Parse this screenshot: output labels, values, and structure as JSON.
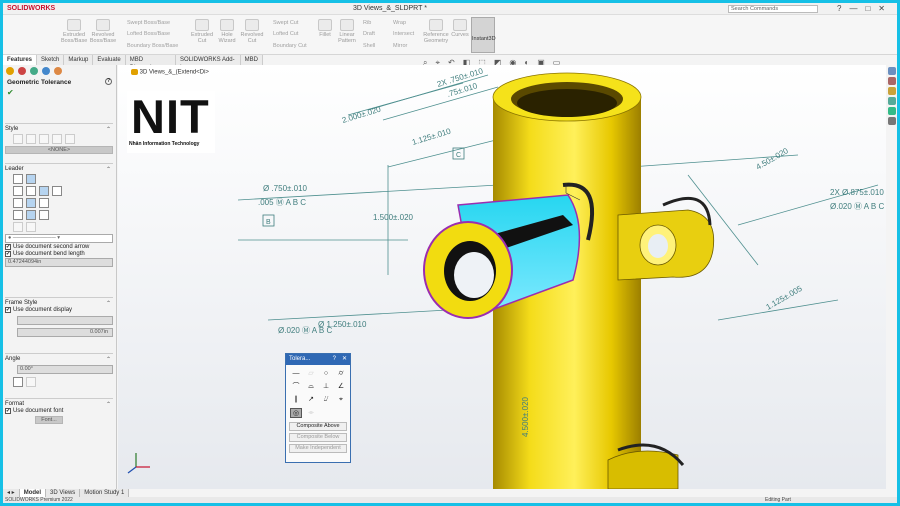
{
  "app": {
    "name": "SOLIDWORKS",
    "document_title": "3D Views_&_SLDPRT *",
    "search_placeholder": "Search Commands",
    "window_buttons": [
      "?",
      "—",
      "□",
      "✕"
    ]
  },
  "ribbon": {
    "commands": [
      {
        "label": "Swept Boss/Base"
      },
      {
        "label": "Extruded Boss/Base"
      },
      {
        "label": "Revolved Boss/Base"
      },
      {
        "label": "Lofted Boss/Base"
      },
      {
        "label": "Boundary Boss/Base"
      },
      {
        "label": "Extruded Cut"
      },
      {
        "label": "Hole Wizard"
      },
      {
        "label": "Revolved Cut"
      },
      {
        "label": "Swept Cut"
      },
      {
        "label": "Lofted Cut"
      },
      {
        "label": "Boundary Cut"
      },
      {
        "label": "Fillet"
      },
      {
        "label": "Linear Pattern"
      },
      {
        "label": "Rib"
      },
      {
        "label": "Draft"
      },
      {
        "label": "Shell"
      },
      {
        "label": "Wrap"
      },
      {
        "label": "Intersect"
      },
      {
        "label": "Mirror"
      },
      {
        "label": "Reference Geometry"
      },
      {
        "label": "Curves"
      },
      {
        "label": "Instant3D"
      }
    ]
  },
  "tabs": [
    "Features",
    "Sketch",
    "Markup",
    "Evaluate",
    "MBD Dimensions",
    "SOLIDWORKS Add-Ins",
    "MBD"
  ],
  "breadcrumb": "3D Views_&_(Extend<Di>",
  "property_manager": {
    "title": "Geometric Tolerance",
    "style_label": "Style",
    "style_value": "<NONE>",
    "leader_label": "Leader",
    "use_second_arrow": "Use document second arrow",
    "use_bend_length": "Use document bend length",
    "bend_length": "0.47244094in",
    "frame_style_label": "Frame Style",
    "use_doc_display": "Use document display",
    "frame_value": "0.007in",
    "angle_label": "Angle",
    "angle_value": "0.00°",
    "format_label": "Format",
    "use_doc_font": "Use document font",
    "font_button": "Font..."
  },
  "logo": {
    "text": "NIT",
    "tagline": "Nhân Information Technology"
  },
  "annotations": {
    "dim1": "2X .750±.010",
    "dim2": ".75±.010",
    "dim3": "2.000±.020",
    "dim4": "1.500±.020",
    "dim5": "Ø .750±.010",
    "dim6": "Ø 1.250±.010",
    "dim7": "4.500±.020",
    "dim8": "2X Ø.875±.010",
    "dim9": "1.125±.010",
    "gtol1": ".005 Ⓜ A B C",
    "gtol2": "Ø.020 Ⓜ A B C",
    "gtol3": "Ø.020 Ⓜ A B C",
    "datum_b": "B",
    "datum_c": "C",
    "dim_small1": "4.50±.020",
    "dim_small2": "1.125±.005"
  },
  "tolerance_popup": {
    "title": "Tolera...",
    "help": "?",
    "close": "✕",
    "symbols": [
      "—",
      "⏥",
      "○",
      "⌭",
      "⌒",
      "⌓",
      "⊥",
      "∠",
      "∥",
      "↗",
      "⌰",
      "⌖",
      "◎",
      "⌯",
      "",
      ""
    ],
    "composite_above": "Composite Above",
    "composite_below": "Composite Below",
    "make_independent": "Make Independent"
  },
  "bottom_tabs": [
    "Model",
    "3D Views",
    "Motion Study 1"
  ],
  "status": {
    "left": "SOLIDWORKS Premium 2022",
    "right": "Editing Part"
  }
}
